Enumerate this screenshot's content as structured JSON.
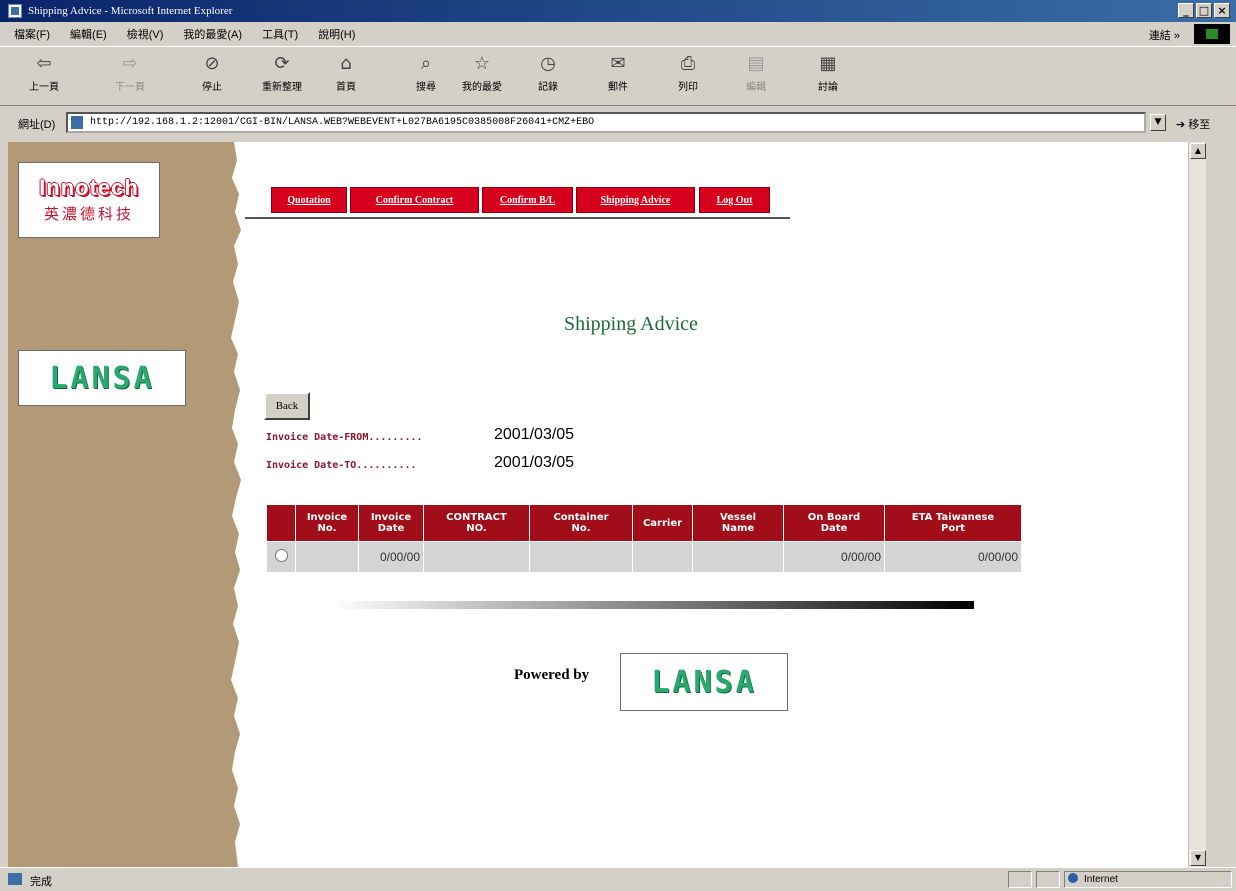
{
  "window": {
    "title": "Shipping Advice - Microsoft Internet Explorer",
    "controls": [
      "_",
      "□",
      "×"
    ]
  },
  "menu": {
    "items": [
      "檔案(F)",
      "編輯(E)",
      "檢視(V)",
      "我的最愛(A)",
      "工具(T)",
      "說明(H)"
    ],
    "links_label": "連結 »"
  },
  "toolbar": {
    "buttons": [
      {
        "label": "上一頁",
        "icon": "back-arrow-icon"
      },
      {
        "label": "下一頁",
        "icon": "forward-arrow-icon"
      },
      {
        "label": "停止",
        "icon": "stop-icon"
      },
      {
        "label": "重新整理",
        "icon": "refresh-icon"
      },
      {
        "label": "首頁",
        "icon": "home-icon"
      },
      {
        "label": "搜尋",
        "icon": "search-icon"
      },
      {
        "label": "我的最愛",
        "icon": "favorites-icon"
      },
      {
        "label": "記錄",
        "icon": "history-icon"
      },
      {
        "label": "郵件",
        "icon": "mail-icon"
      },
      {
        "label": "列印",
        "icon": "print-icon"
      },
      {
        "label": "編輯",
        "icon": "edit-icon"
      },
      {
        "label": "討論",
        "icon": "discuss-icon"
      }
    ]
  },
  "address": {
    "label": "網址(D)",
    "url": "http://192.168.1.2:12001/CGI-BIN/LANSA.WEB?WEBEVENT+L027BA6195C0385008F26041+CMZ+EBO",
    "go_label": "移至"
  },
  "sidebar": {
    "logo_en": "Innotech",
    "logo_cn": "英濃德科技",
    "lansa_logo": "LANSA"
  },
  "tabs": [
    "Quotation",
    "Confirm Contract",
    "Confirm B/L",
    "Shipping Advice",
    "Log Out"
  ],
  "page": {
    "title": "Shipping Advice",
    "back_label": "Back",
    "date_from_label": "Invoice Date-FROM.........",
    "date_from_value": "2001/03/05",
    "date_to_label": "Invoice Date-TO..........",
    "date_to_value": "2001/03/05"
  },
  "grid": {
    "headers": [
      {
        "l1": "",
        "l2": ""
      },
      {
        "l1": "Invoice",
        "l2": "No."
      },
      {
        "l1": "Invoice",
        "l2": "Date"
      },
      {
        "l1": "CONTRACT",
        "l2": "NO."
      },
      {
        "l1": "Container",
        "l2": "No."
      },
      {
        "l1": "Carrier",
        "l2": ""
      },
      {
        "l1": "Vessel",
        "l2": "Name"
      },
      {
        "l1": "On Board",
        "l2": "Date"
      },
      {
        "l1": "ETA Taiwanese",
        "l2": "Port"
      }
    ],
    "rows": [
      [
        "",
        "",
        "0/00/00",
        "",
        "",
        "",
        "",
        "0/00/00",
        "0/00/00"
      ]
    ]
  },
  "footer": {
    "powered_by": "Powered by",
    "lansa_logo": "LANSA"
  },
  "status": {
    "text": "完成",
    "zone": "Internet"
  },
  "colors": {
    "tab_red": "#d6001c",
    "header_red": "#a10d18",
    "title_green": "#1e6a3a",
    "label_maroon": "#8a1830",
    "sidebar_tan": "#b39a76"
  }
}
